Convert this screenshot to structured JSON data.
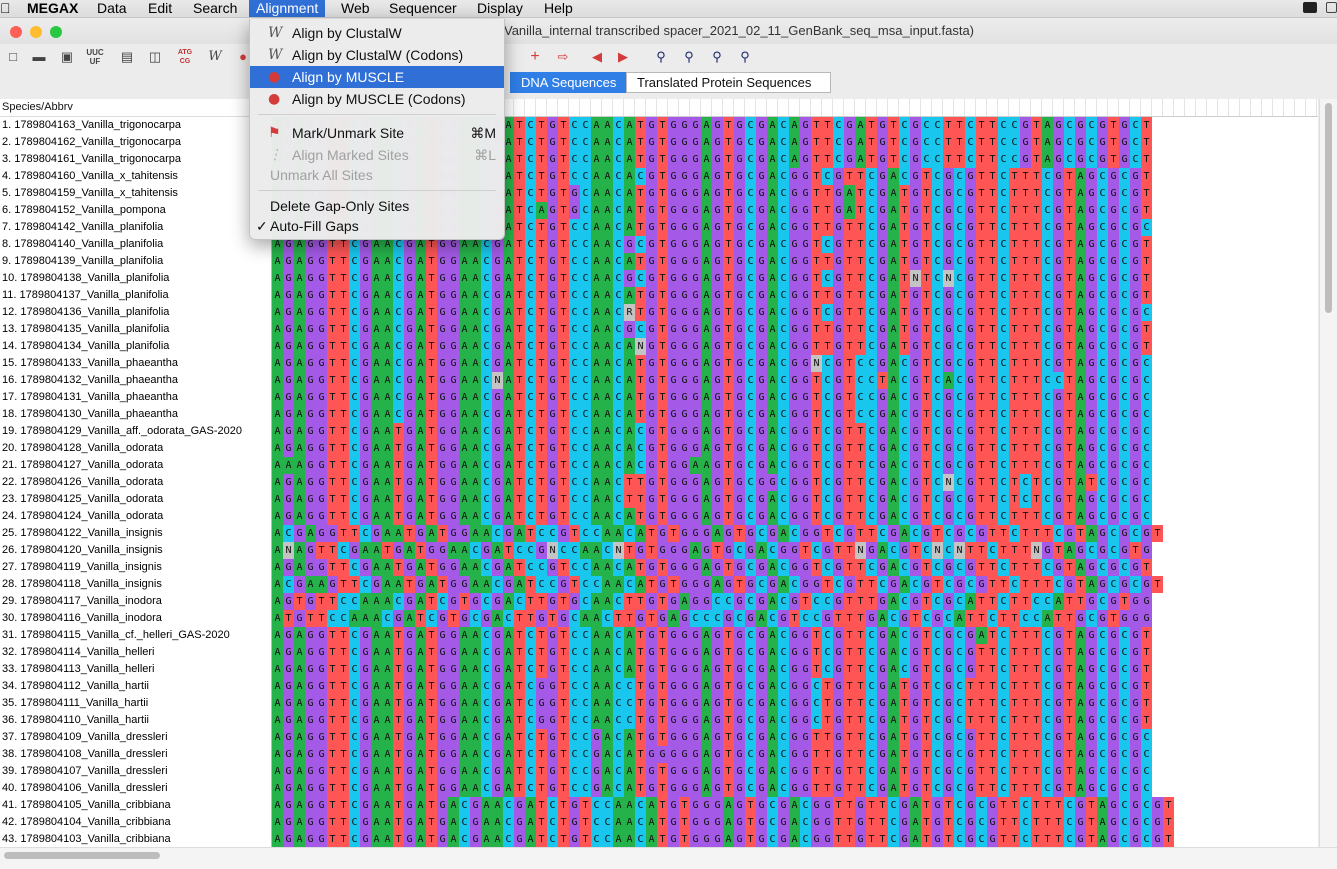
{
  "menubar": {
    "items": [
      "MEGAX",
      "Data",
      "Edit",
      "Search",
      "Alignment",
      "Web",
      "Sequencer",
      "Display",
      "Help"
    ],
    "active": "Alignment"
  },
  "window": {
    "title": "Vanilla_internal transcribed spacer_2021_02_11_GenBank_seq_msa_input.fasta)"
  },
  "toolbar": {
    "left_icons": [
      "new-file-icon",
      "open-folder-icon",
      "save-icon",
      "uuc-icon",
      "document-icon",
      "columns-icon",
      "atg-cg-icon",
      "w-icon",
      "muscle-icon"
    ],
    "right_icons": [
      "add-icon",
      "export-icon",
      "prev-icon",
      "next-icon",
      "search-icon",
      "find-prev-icon",
      "find-next-icon",
      "find-motif-icon"
    ]
  },
  "tabs": {
    "dna": "DNA Sequences",
    "protein": "Translated Protein Sequences"
  },
  "names_header": "Species/Abbrv",
  "menu": {
    "items": [
      {
        "label": "Align by ClustalW",
        "icon": "W",
        "shortcut": "",
        "state": "normal"
      },
      {
        "label": "Align by ClustalW (Codons)",
        "icon": "W",
        "shortcut": "",
        "state": "normal"
      },
      {
        "label": "Align by MUSCLE",
        "icon": "muscle",
        "shortcut": "",
        "state": "highlighted"
      },
      {
        "label": "Align by MUSCLE (Codons)",
        "icon": "muscle",
        "shortcut": "",
        "state": "normal"
      },
      {
        "label": "Mark/Unmark Site",
        "icon": "flag",
        "shortcut": "⌘M",
        "state": "normal"
      },
      {
        "label": "Align Marked Sites",
        "icon": "marked",
        "shortcut": "⌘L",
        "state": "disabled"
      },
      {
        "label": "Unmark All Sites",
        "icon": "",
        "shortcut": "",
        "state": "disabled"
      },
      {
        "label": "Delete Gap-Only Sites",
        "icon": "",
        "shortcut": "",
        "state": "normal"
      },
      {
        "label": "Auto-Fill Gaps",
        "icon": "",
        "shortcut": "",
        "state": "checked"
      }
    ]
  },
  "sequences": [
    {
      "name": "1. 1789804163_Vanilla_trigonocarpa",
      "seq": "AGAGGTTCGAACGATGGAACGATCTGTCCAACATGTGGGAGTGCGACAGTTCGATGTCGCCTTCTTCCGTAGCGCGTGCT"
    },
    {
      "name": "2. 1789804162_Vanilla_trigonocarpa",
      "seq": "AGAGGTTCGAACGATGGAACGATCTGTCCAACATGTGGGAGTGCGACAGTTCGATGTCGCCTTCTTCCGTAGCGCGTGCT"
    },
    {
      "name": "3. 1789804161_Vanilla_trigonocarpa",
      "seq": "AGAGGTTCGAACGATGGAACGATCTGTCCAACATGTGGGAGTGCGACAGTTCGATGTCGCCTTCTTCCGTAGCGCGTGCT"
    },
    {
      "name": "4. 1789804160_Vanilla_x_tahitensis",
      "seq": "AGAGGTTCGAACGATGGAACGATCTGTCCAACACGTGGGAGTGCGACGGTCGTTCGACGTCGCGTTCTTTCGTAGCGCGT"
    },
    {
      "name": "5. 1789804159_Vanilla_x_tahitensis",
      "seq": "AGAGGTTCGAACGATGGAACGATCTGTGCAACATGTGGGAGTGCGACGGTTGATCGATGTCGCGTTCTTTCGTAGCGCGT"
    },
    {
      "name": "6. 1789804152_Vanilla_pompona",
      "seq": "AGAGGTTCGAACGATGGAACGATCAGTGCAACATGTGGGAGTGCGACGGTTGATCGATGTCGCGTTCTTTCGTAGCGCGT"
    },
    {
      "name": "7. 1789804142_Vanilla_planifolia",
      "seq": "AGAGGTTCGAACGATGGAACGATCTGTCCAACATGTGGGAGTGCGACGGTTGTTCGATGTCGCGTTCTTTCGTAGCGCGC"
    },
    {
      "name": "8. 1789804140_Vanilla_planifolia",
      "seq": "AGAGGTTCGAACGATGGAACGATCTGTCCAACGCGTGGGAGTGCGACGGTCGTTCGATGTCGCGTTCTTTCGTAGCGCGT"
    },
    {
      "name": "9. 1789804139_Vanilla_planifolia",
      "seq": "AGAGGTTCGAACGATGGAACGATCTGTCCAACATGTGGGAGTGCGACGGTTGTTCGATGTCGCGTTCTTTCGTAGCGCGT"
    },
    {
      "name": "10. 1789804138_Vanilla_planifolia",
      "seq": "AGAGGTTCGAACGATGGAACGATCTGTCCAACGCGTGGGAGTGCGACGGTCGTTCGATNTCNCGTTCTTTCGTAGCGCGT"
    },
    {
      "name": "11. 1789804137_Vanilla_planifolia",
      "seq": "AGAGGTTCGAACGATGGAACGATCTGTCCAACATGTGGGAGTGCGACGGTTGTTCGATGTCGCGTTCTTTCGTAGCGCGT"
    },
    {
      "name": "12. 1789804136_Vanilla_planifolia",
      "seq": "AGAGGTTCGAACGATGGAACGATCTGTCCAACRTGTGGGAGTGCGACGGTCGTTCGATGTCGCGTTCTTTCGTAGCGCGC"
    },
    {
      "name": "13. 1789804135_Vanilla_planifolia",
      "seq": "AGAGGTTCGAACGATGGAACGATCTGTCCAACGCGTGGGAGTGCGACGGTTGTTCGATGTCGCGTTCTTTCGTAGCGCGT"
    },
    {
      "name": "14. 1789804134_Vanilla_planifolia",
      "seq": "AGAGGTTCGAACGATGGAACGATCTGTCCAACANGTGGGAGTGCGACGGTTGTTCGATGTCGCGTTCTTTCGTAGCGCGT"
    },
    {
      "name": "15. 1789804133_Vanilla_phaeantha",
      "seq": "AGAGGTTCGAACGATGGAACGATCTGTCCAACATGTGGGAGTGCGACGGNCGTCCGACGTCGCGTTCTTTCGTAGCGCGC"
    },
    {
      "name": "16. 1789804132_Vanilla_phaeantha",
      "seq": "AGAGGTTCGAACGATGGAACNATCTGTCCAACATGTGGGAGTGCGACGGTCGTCCTACGTCACGTTCTTTCCTAGCGCGC"
    },
    {
      "name": "17. 1789804131_Vanilla_phaeantha",
      "seq": "AGAGGTTCGAACGATGGAACGATCTGTCCAACATGTGGGAGTGCGACGGTCGTCCGACGTCGCGTTCTTTCGTAGCGCGC"
    },
    {
      "name": "18. 1789804130_Vanilla_phaeantha",
      "seq": "AGAGGTTCGAACGATGGAACGATCTGTCCAACATGTGGGAGTGCGACGGTCGTCCGACGTCGCGTTCTTTCGTAGCGCGC"
    },
    {
      "name": "19. 1789804129_Vanilla_aff._odorata_GAS-2020",
      "seq": "AGAGGTTCGAATGATGGAACGATCTGTCCAACACGTGGGAGTGCGACGGTCGTTCGACGTCGCGTTCTTTCGTAGCGCGC"
    },
    {
      "name": "20. 1789804128_Vanilla_odorata",
      "seq": "AGAGGTTCGAATGATGGAACGATCTGTCCAACACGTGGGAGTGCGACGGTCGTTCGACGTCGCGTTCTTTCGTAGCGCGC"
    },
    {
      "name": "21. 1789804127_Vanilla_odorata",
      "seq": "AAAGGTTCGAATGATGGAACGATCTGTCCAACACGTGGAAGTGCGACGGTCGTTCGACGTCGCGTTCTTTCGTAGCGCGC"
    },
    {
      "name": "22. 1789804126_Vanilla_odorata",
      "seq": "AGAGGTTCGAATGATGGAACGATCTGTCCAACTTGTGGGAGTGCGGCGGTCGTTCGACGTCNCGTTCTCTCGTATCGCGC"
    },
    {
      "name": "23. 1789804125_Vanilla_odorata",
      "seq": "AGAGGTTCGAATGATGGAACGATCTGTCCAACTTGTGGGAGTGCGACGGTCGTTCGACGTCGCGTTCTCTCGTAGCGCGC"
    },
    {
      "name": "24. 1789804124_Vanilla_odorata",
      "seq": "AGAGGTTCGAATGATGGAACGATCTGTCCAACATGTGGGAGTGCGACGGTCGTTCGACGTCGCGTTCTTTCGTAGCGCGC"
    },
    {
      "name": "25. 1789804122_Vanilla_insignis",
      "seq": "ACGAGGTTCGAATGATGGAACGATCCGTCCAACATGTGGGAGTGCGACGGTCGTTCGACGTCGCGTTCTTTCGTAGCGCGT"
    },
    {
      "name": "26. 1789804120_Vanilla_insignis",
      "seq": "ANAGTTCGAATGATGGAACGATCCGNCCAACNTGTGGGAGTGCGACGGTCGTTNGACGTCNCNTTCTTTNGTAGCGCGTG"
    },
    {
      "name": "27. 1789804119_Vanilla_insignis",
      "seq": "AGAGGTTCGAATGATGGAACGATCCGTCCAACATGTGGGAGTGCGACGGTCGTTCGACGTCGCGTTCTTTCGTAGCGCGT"
    },
    {
      "name": "28. 1789804118_Vanilla_insignis",
      "seq": "ACGAAGTTCGAATGATGGAACGATCCGTCCAACATGTGGGAGTGCGACGGTCGTTCGACGTCGCGTTCTTTCGTAGCGCGT"
    },
    {
      "name": "29. 1789804117_Vanilla_inodora",
      "seq": "AGTGTTCCAAACGATCGTGCGACTTGTGCAACTTGTGAGGCCGCGACGTCCGTTTGACGTCGCATTCTTCCATTGCGTGG"
    },
    {
      "name": "30. 1789804116_Vanilla_inodora",
      "seq": "ATGTTCCAAACGATCGTGCGACTTGTGCAACTTGTGAGCCCGCGACGTCCGTTTGACGTCGCATTCTTCCATTGCGTGGG"
    },
    {
      "name": "31. 1789804115_Vanilla_cf._helleri_GAS-2020",
      "seq": "AGAGGTTCGAATGATGGAACGATCTGTCCAACATGTGGGAGTGCGACGGTCGTTCGACGTCGCGATCTTTCGTAGCGCGT"
    },
    {
      "name": "32. 1789804114_Vanilla_helleri",
      "seq": "AGAGGTTCGAATGATGGAACGATCTGTCCAACATGTGGGAGTGCGACGGTCGTTCGACGTCGCGTTCTTTCGTAGCGCGT"
    },
    {
      "name": "33. 1789804113_Vanilla_helleri",
      "seq": "AGAGGTTCGAATGATGGAACGATCTGTCCAACATGTGGGAGTGCGACGGTCGTTCGACGTCGCGTTCTTTCGTAGCGCGT"
    },
    {
      "name": "34. 1789804112_Vanilla_hartii",
      "seq": "AGAGGTTCGAATGATGGAACGATCGGTCCAACCTGTGGGAGTGCGACGGCTGTTCGATGTCGCTTTCTTTCGTAGCGCGT"
    },
    {
      "name": "35. 1789804111_Vanilla_hartii",
      "seq": "AGAGGTTCGAATGATGGAACGATCGGTCCAACCTGTGGGAGTGCGACGGCTGTTCGATGTCGCTTTCTTTCGTAGCGCGT"
    },
    {
      "name": "36. 1789804110_Vanilla_hartii",
      "seq": "AGAGGTTCGAATGATGGAACGATCGGTCCAACCTGTGGGAGTGCGACGGCTGTTCGATGTCGCTTTCTTTCGTAGCGCGT"
    },
    {
      "name": "37. 1789804109_Vanilla_dressleri",
      "seq": "AGAGGTTCGAATGATGGAACGATCTGTCCGACATGTGGGAGTGCGACGGTTGTTCGATGTCGCGTTCTTTCGTAGCGCGC"
    },
    {
      "name": "38. 1789804108_Vanilla_dressleri",
      "seq": "AGAGGTTCGAATGATGGAACGATCTGTCCGACATGGGGGAGTGCGACGGTTGTTCGATGTCGCGTTCTTTCGTAGCGCGC"
    },
    {
      "name": "39. 1789804107_Vanilla_dressleri",
      "seq": "AGAGGTTCGAATGATGGAACGATCTGTCCGACATGTGGGAGTGCGACGGTTGTTCGATGTCGCGTTCTTTCGTAGCGCGC"
    },
    {
      "name": "40. 1789804106_Vanilla_dressleri",
      "seq": "AGAGGTTCGAATGATGGAACGATCTGTCCGACATGTGGGAGTGCGACGGTTGTTCGATGTCGCGTTCTTTCGTAGCGCGC"
    },
    {
      "name": "41. 1789804105_Vanilla_cribbiana",
      "seq": "AGAGGTTCGAATGATGACGAACGATCTGTCCAACATGTGGGAGTGCGACGGTTGTTCGATGTCGCGTTCTTTCGTAGCGCGT"
    },
    {
      "name": "42. 1789804104_Vanilla_cribbiana",
      "seq": "AGAGGTTCGAATGATGACGAACGATCTGTCCAACATGTGGGAGTGCGACGGTTGTTCGATGTCGCGTTCTTTCGTAGCGCGT"
    },
    {
      "name": "43. 1789804103_Vanilla_cribbiana",
      "seq": "AGAGGTTCGAATGATGACGAACGATCTGTCCAACATGTGGGAGTGCGACGGTTGTTCGATGTCGCGTTCTTTCGTAGCGCGT"
    }
  ],
  "colors": {
    "A": "#26b24a",
    "G": "#a45ae6",
    "C": "#19c7ee",
    "T": "#ff5555",
    "N": "#c4c4c4",
    "menu_highlight": "#2f6fd6",
    "tab_selected": "#2f7fe6"
  }
}
